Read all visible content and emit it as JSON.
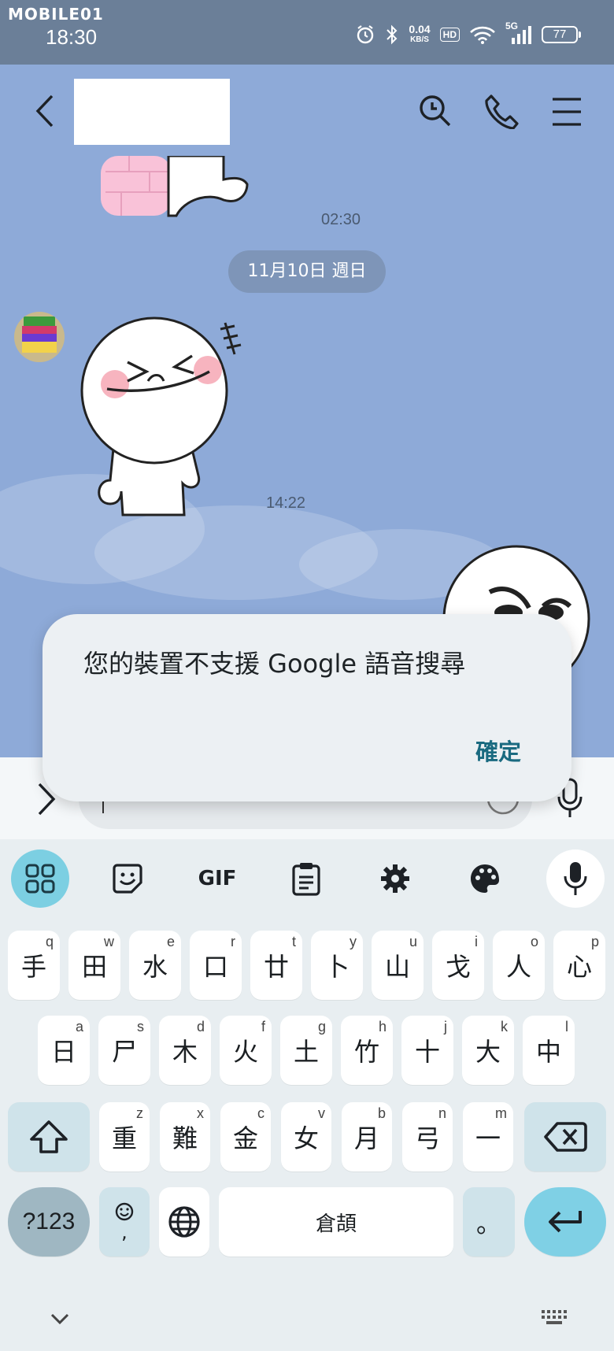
{
  "status_bar": {
    "watermark": "MOBILE01",
    "time": "18:30",
    "net_speed": "0.04",
    "net_unit": "KB/S",
    "hd": "HD",
    "signal_label": "5G",
    "battery": "77"
  },
  "chat": {
    "timestamps": [
      "02:30",
      "14:22"
    ],
    "date_chip": "11月10日 週日"
  },
  "dialog": {
    "message": "您的裝置不支援 Google 語音搜尋",
    "ok_label": "確定"
  },
  "keyboard": {
    "toolbar": [
      "apps-icon",
      "sticker-icon",
      "gif-icon",
      "clipboard-icon",
      "settings-icon",
      "theme-palette-icon",
      "mic-icon"
    ],
    "gif_label": "GIF",
    "row1": [
      {
        "char": "手",
        "hint": "q"
      },
      {
        "char": "田",
        "hint": "w"
      },
      {
        "char": "水",
        "hint": "e"
      },
      {
        "char": "口",
        "hint": "r"
      },
      {
        "char": "廿",
        "hint": "t"
      },
      {
        "char": "卜",
        "hint": "y"
      },
      {
        "char": "山",
        "hint": "u"
      },
      {
        "char": "戈",
        "hint": "i"
      },
      {
        "char": "人",
        "hint": "o"
      },
      {
        "char": "心",
        "hint": "p"
      }
    ],
    "row2": [
      {
        "char": "日",
        "hint": "a"
      },
      {
        "char": "尸",
        "hint": "s"
      },
      {
        "char": "木",
        "hint": "d"
      },
      {
        "char": "火",
        "hint": "f"
      },
      {
        "char": "土",
        "hint": "g"
      },
      {
        "char": "竹",
        "hint": "h"
      },
      {
        "char": "十",
        "hint": "j"
      },
      {
        "char": "大",
        "hint": "k"
      },
      {
        "char": "中",
        "hint": "l"
      }
    ],
    "row3": [
      {
        "char": "重",
        "hint": "z"
      },
      {
        "char": "難",
        "hint": "x"
      },
      {
        "char": "金",
        "hint": "c"
      },
      {
        "char": "女",
        "hint": "v"
      },
      {
        "char": "月",
        "hint": "b"
      },
      {
        "char": "弓",
        "hint": "n"
      },
      {
        "char": "一",
        "hint": "m"
      }
    ],
    "symbols_label": "?123",
    "emoji_comma": ",",
    "space_label": "倉頡",
    "period_label": "。"
  },
  "colors": {
    "chat_bg": "#8eaad8",
    "status_bar": "#6b7f98",
    "accent": "#1a6a80",
    "enter_key": "#7fd0e5"
  }
}
